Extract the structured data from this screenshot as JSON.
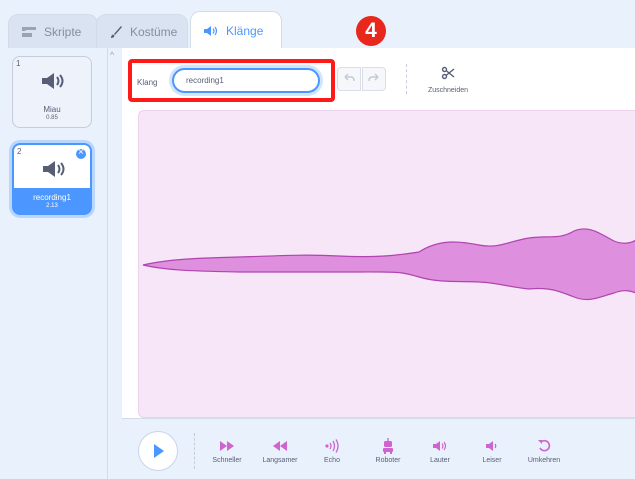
{
  "tabs": {
    "skripte": "Skripte",
    "kostume": "Kostüme",
    "klange": "Klänge"
  },
  "sounds": [
    {
      "number": "1",
      "name": "Miau",
      "duration": "0.85"
    },
    {
      "number": "2",
      "name": "recording1",
      "duration": "2.13"
    }
  ],
  "toolbar": {
    "sound_label": "Klang",
    "sound_name_value": "recording1",
    "cut_label": "Zuschneiden"
  },
  "annotation": {
    "step_badge": "4"
  },
  "effects": [
    "Schneller",
    "Langsamer",
    "Echo",
    "Roboter",
    "Lauter",
    "Leiser",
    "Umkehren"
  ],
  "colors": {
    "accent": "#4c97ff",
    "sound_wave": "#cf63cf",
    "wave_background": "#f6e6f7",
    "highlight_box": "#ff1a1a"
  }
}
